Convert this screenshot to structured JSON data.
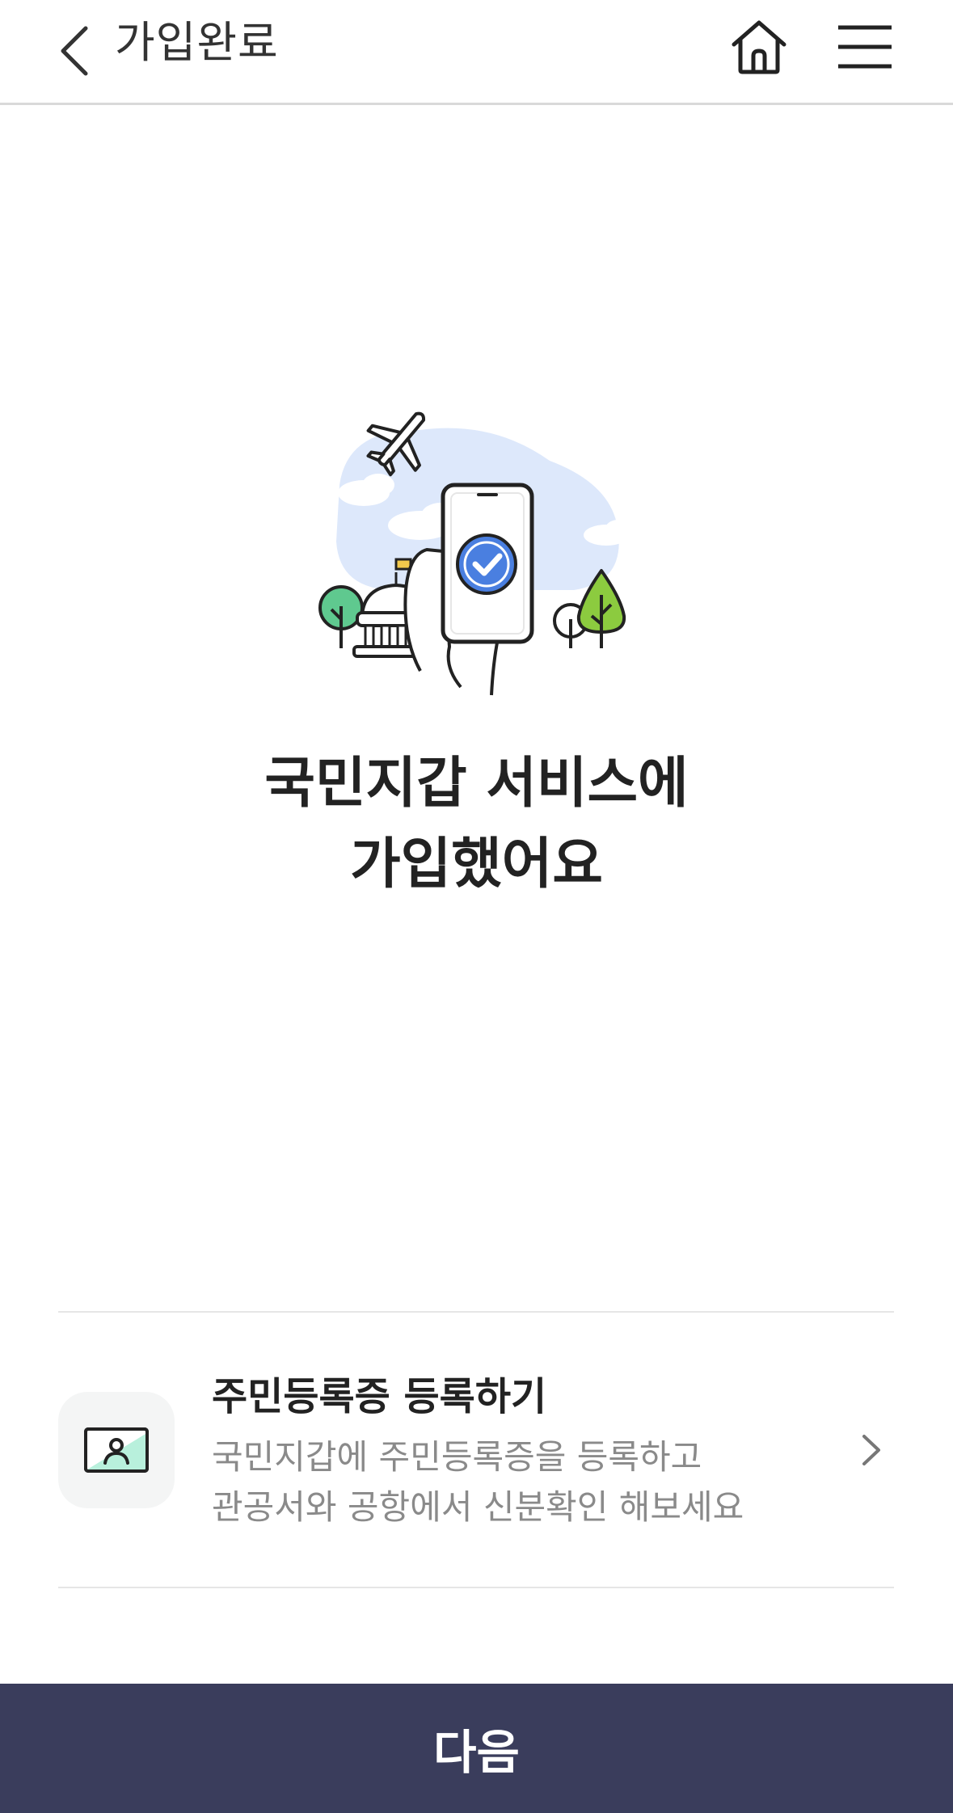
{
  "header": {
    "title": "가입완료",
    "back_icon": "chevron-left-icon",
    "home_icon": "home-icon",
    "menu_icon": "hamburger-menu-icon"
  },
  "illustration": {
    "name": "phone-check-illustration",
    "accent_color": "#4a7fe0",
    "sky_color": "#dde8fb",
    "tree_colors": [
      "#5fc98f",
      "#8ccb3f"
    ]
  },
  "main": {
    "headline_line1": "국민지갑 서비스에",
    "headline_line2": "가입했어요"
  },
  "register_card": {
    "title": "주민등록증 등록하기",
    "description_line1": "국민지갑에 주민등록증을 등록하고",
    "description_line2": "관공서와 공항에서 신분확인 해보세요",
    "icon": "id-card-icon",
    "icon_accent_color": "#b8f0dc",
    "chevron_icon": "chevron-right-icon"
  },
  "footer": {
    "next_label": "다음",
    "button_color": "#3a3d5c"
  }
}
